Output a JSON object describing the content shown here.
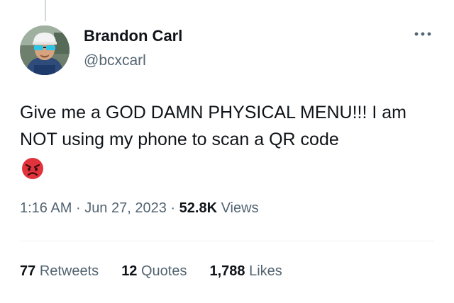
{
  "author": {
    "display_name": "Brandon Carl",
    "handle": "@bcxcarl"
  },
  "tweet": {
    "text": "Give me a GOD DAMN PHYSICAL MENU!!! I am NOT using my phone to scan a QR code",
    "emoji": "angry-face-emoji"
  },
  "meta": {
    "time": "1:16 AM",
    "separator": "·",
    "date": "Jun 27, 2023",
    "views_count": "52.8K",
    "views_label": "Views"
  },
  "stats": {
    "retweets_count": "77",
    "retweets_label": "Retweets",
    "quotes_count": "12",
    "quotes_label": "Quotes",
    "likes_count": "1,788",
    "likes_label": "Likes"
  },
  "icons": {
    "more": "more-horizontal-icon"
  },
  "colors": {
    "text_primary": "#0f1419",
    "text_secondary": "#536471",
    "divider": "#eff3f4",
    "emoji_red": "#e0333c"
  }
}
